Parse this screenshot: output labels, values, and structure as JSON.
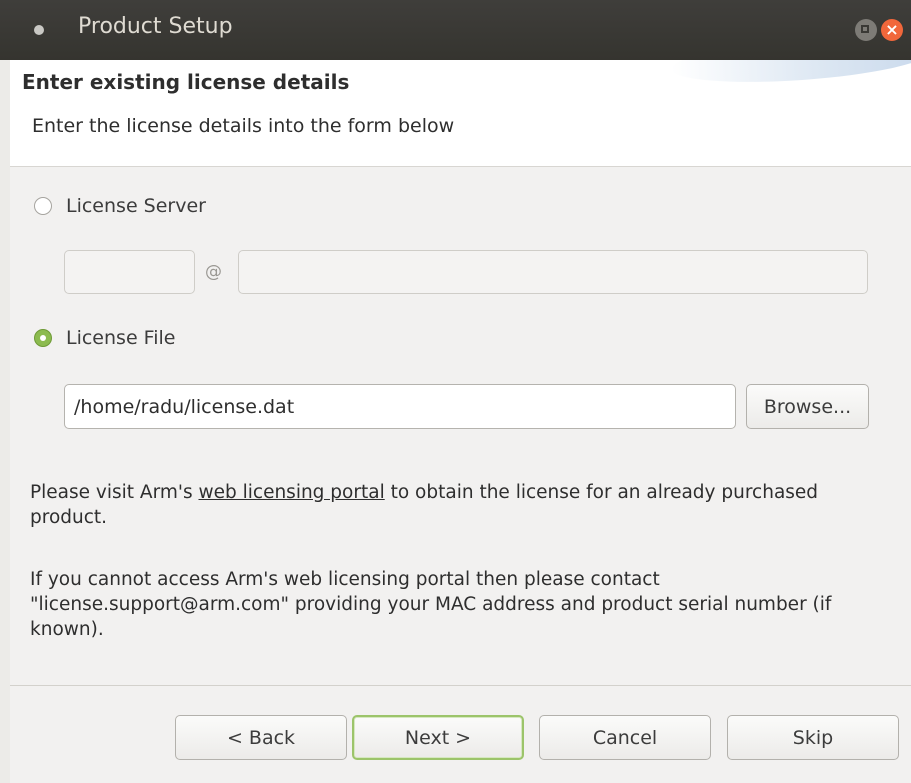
{
  "window": {
    "title": "Product Setup"
  },
  "header": {
    "title": "Enter existing license details",
    "subtitle": "Enter the license details into the form below"
  },
  "form": {
    "license_server": {
      "label": "License Server",
      "selected": false,
      "port_value": "",
      "host_value": "",
      "separator": "@"
    },
    "license_file": {
      "label": "License File",
      "selected": true,
      "path_value": "/home/radu/license.dat",
      "browse_label": "Browse..."
    }
  },
  "info": {
    "para1_prefix": "Please visit Arm's ",
    "para1_link": "web licensing portal",
    "para1_suffix": " to obtain the license for an already purchased product.",
    "para2": "If you cannot access Arm's web licensing portal then please contact \"license.support@arm.com\" providing your MAC address and product serial number (if known)."
  },
  "buttons": {
    "back": "< Back",
    "next": "Next >",
    "cancel": "Cancel",
    "skip": "Skip"
  }
}
